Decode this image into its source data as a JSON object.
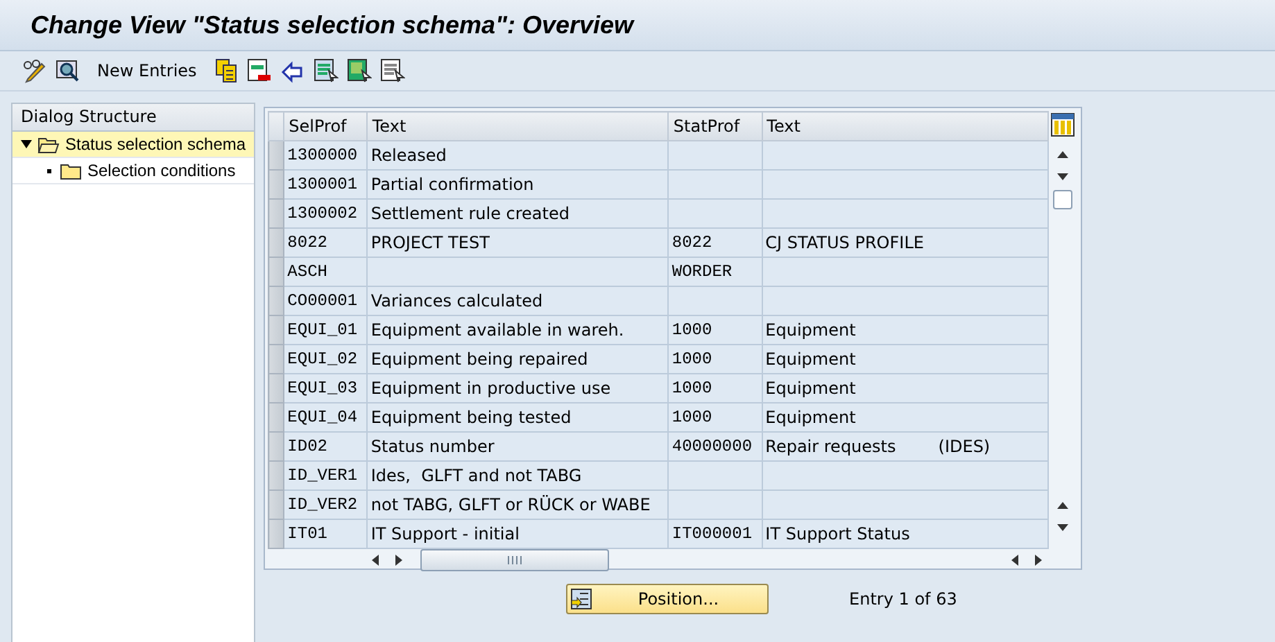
{
  "window": {
    "title": "Change View \"Status selection schema\": Overview"
  },
  "toolbar": {
    "new_entries": "New Entries"
  },
  "dialog_structure": {
    "title": "Dialog Structure",
    "items": [
      {
        "label": "Status selection schema",
        "expanded": true,
        "selected": true,
        "children": [
          {
            "label": "Selection conditions",
            "expanded": false,
            "selected": false
          }
        ]
      }
    ]
  },
  "table": {
    "columns": [
      {
        "label": "SelProf",
        "kind": "code"
      },
      {
        "label": "Text",
        "kind": "text"
      },
      {
        "label": "StatProf",
        "kind": "code"
      },
      {
        "label": "Text",
        "kind": "text"
      }
    ],
    "rows": [
      [
        "1300000",
        "Released",
        "",
        ""
      ],
      [
        "1300001",
        "Partial confirmation",
        "",
        ""
      ],
      [
        "1300002",
        "Settlement rule created",
        "",
        ""
      ],
      [
        "8022",
        "PROJECT TEST",
        "8022",
        "CJ STATUS PROFILE"
      ],
      [
        "ASCH",
        "",
        "WORDER",
        ""
      ],
      [
        "CO00001",
        "Variances calculated",
        "",
        ""
      ],
      [
        "EQUI_01",
        "Equipment available in wareh.",
        "1000",
        "Equipment"
      ],
      [
        "EQUI_02",
        "Equipment being repaired",
        "1000",
        "Equipment"
      ],
      [
        "EQUI_03",
        "Equipment in productive use",
        "1000",
        "Equipment"
      ],
      [
        "EQUI_04",
        "Equipment being tested",
        "1000",
        "Equipment"
      ],
      [
        "ID02",
        "Status number",
        "40000000",
        "Repair requests        (IDES)"
      ],
      [
        "ID_VER1",
        "Ides,  GLFT and not TABG",
        "",
        ""
      ],
      [
        "ID_VER2",
        "not TABG, GLFT or RÜCK or WABE",
        "",
        ""
      ],
      [
        "IT01",
        "IT Support - initial",
        "IT000001",
        "IT Support Status"
      ]
    ]
  },
  "footer": {
    "position_button": "Position...",
    "entry_info": "Entry 1 of 63"
  }
}
